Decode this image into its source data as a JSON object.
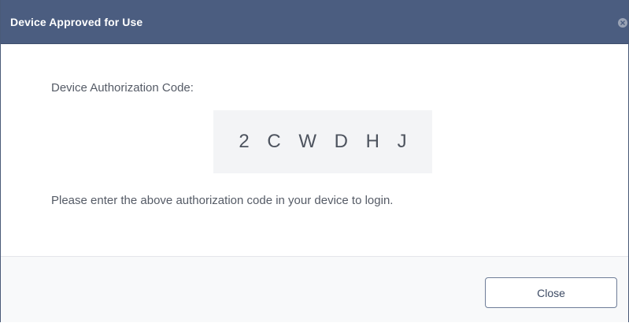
{
  "dialog": {
    "title": "Device Approved for Use",
    "close_icon": "close-circle-icon",
    "code_label": "Device Authorization Code:",
    "code": "2 C W D H J",
    "instructions": "Please enter the above authorization code in your device to login.",
    "close_button_label": "Close"
  },
  "colors": {
    "titlebar": "#4b5d80",
    "code_box": "#f3f4f6",
    "footer": "#f8f9fa",
    "button_border": "#6e7d98"
  }
}
